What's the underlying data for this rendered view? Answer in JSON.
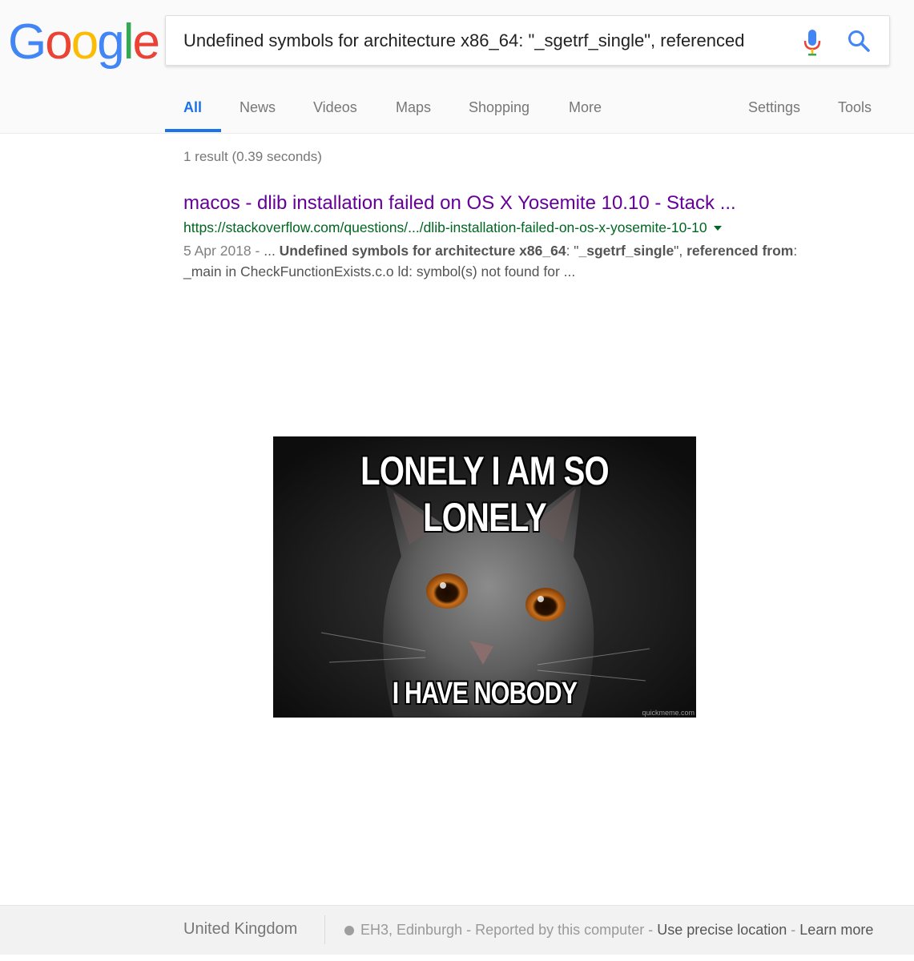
{
  "logo": {
    "letters": [
      "G",
      "o",
      "o",
      "g",
      "l",
      "e"
    ],
    "colors": [
      "#4285F4",
      "#EA4335",
      "#FBBC05",
      "#4285F4",
      "#34A853",
      "#EA4335"
    ]
  },
  "search": {
    "query": "Undefined symbols for architecture x86_64: \"_sgetrf_single\", referenced"
  },
  "tabs": [
    "All",
    "News",
    "Videos",
    "Maps",
    "Shopping",
    "More"
  ],
  "tools": [
    "Settings",
    "Tools"
  ],
  "stats": "1 result (0.39 seconds)",
  "result": {
    "title": "macos - dlib installation failed on OS X Yosemite 10.10 - Stack ...",
    "url": "https://stackoverflow.com/questions/.../dlib-installation-failed-on-os-x-yosemite-10-10",
    "date": "5 Apr 2018 - ",
    "snippet_parts": [
      "... ",
      "Undefined symbols for architecture x86_64",
      ": \"",
      "_sgetrf_single",
      "\", ",
      "referenced from",
      ":"
    ],
    "snippet_line2": "_main in CheckFunctionExists.c.o ld: symbol(s) not found for ..."
  },
  "meme": {
    "top_text": "LONELY I AM SO LONELY",
    "bottom_text": "I HAVE NOBODY",
    "watermark": "quickmeme.com"
  },
  "footer": {
    "country": "United Kingdom",
    "location": "EH3, Edinburgh",
    "reported": "Reported by this computer",
    "precise": "Use precise location",
    "learn": "Learn more",
    "dash": " - "
  },
  "colors": {
    "accent": "#1a73e8",
    "visited_link": "#660099",
    "url_green": "#006621"
  }
}
